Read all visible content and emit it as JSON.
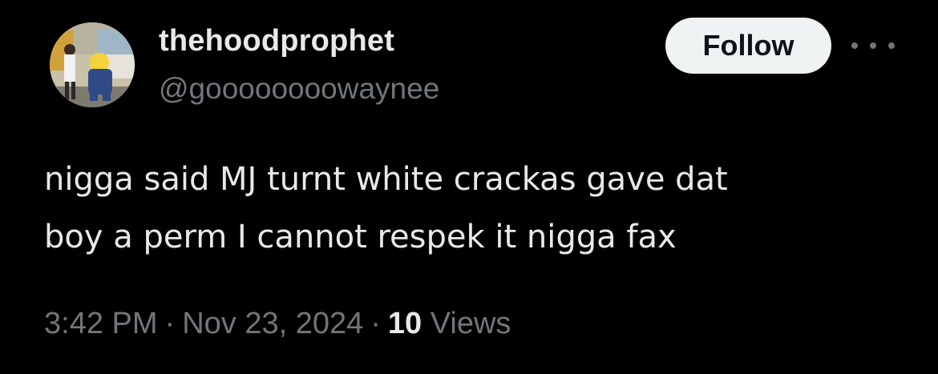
{
  "user": {
    "display_name": "thehoodprophet",
    "handle": "@goooooooowaynee",
    "avatar_icon": "profile-photo"
  },
  "actions": {
    "follow_label": "Follow",
    "more_icon": "more-horizontal-icon"
  },
  "tweet": {
    "text_lines": [
      "nigga said MJ turnt white crackas gave dat",
      "boy a perm I cannot respek it nigga fax"
    ]
  },
  "meta": {
    "time": "3:42 PM",
    "separator": "·",
    "date": "Nov 23, 2024",
    "views_count": "10",
    "views_label": "Views"
  },
  "colors": {
    "background": "#000000",
    "primary_text": "#e7e9ea",
    "secondary_text": "#71767b",
    "follow_bg": "#eff3f4",
    "follow_text": "#0f1419"
  }
}
